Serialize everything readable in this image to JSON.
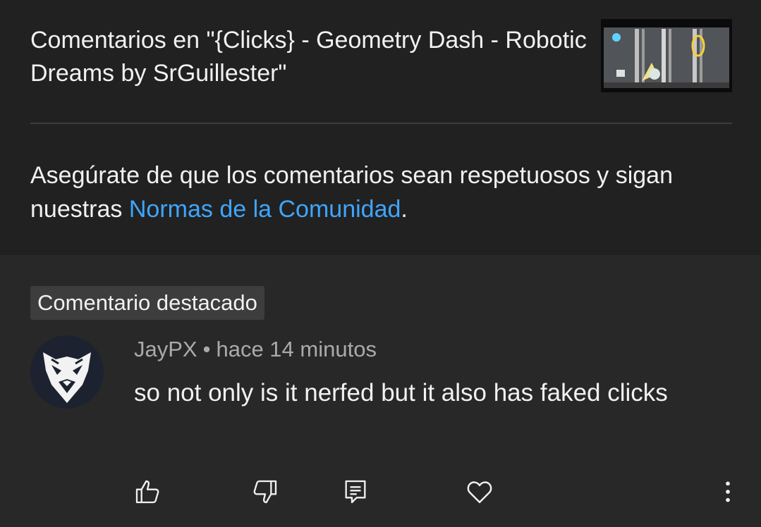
{
  "header": {
    "title": "Comentarios en \"{Clicks} - Geometry Dash - Robotic Dreams by SrGuillester\"",
    "thumbnail_icon": "video-thumbnail"
  },
  "guidelines": {
    "prefix": "Asegúrate de que los comentarios sean respetuosos y sigan nuestras ",
    "link_text": "Normas de la Comunidad",
    "suffix": "."
  },
  "comment": {
    "badge": "Comentario destacado",
    "author": "JayPX",
    "separator": "•",
    "time": "hace 14 minutos",
    "text": "so not only is it nerfed but it also has faked clicks",
    "avatar_icon": "wolf-avatar-icon"
  },
  "actions": {
    "like_icon": "thumbs-up-icon",
    "dislike_icon": "thumbs-down-icon",
    "reply_icon": "reply-icon",
    "heart_icon": "heart-icon",
    "more_icon": "more-vertical-icon"
  },
  "colors": {
    "background": "#282828",
    "top_background": "#212121",
    "link": "#3ea6ff",
    "text_primary": "#f1f1f1",
    "text_secondary": "#aaaaaa",
    "badge_bg": "#3d3d3d"
  }
}
